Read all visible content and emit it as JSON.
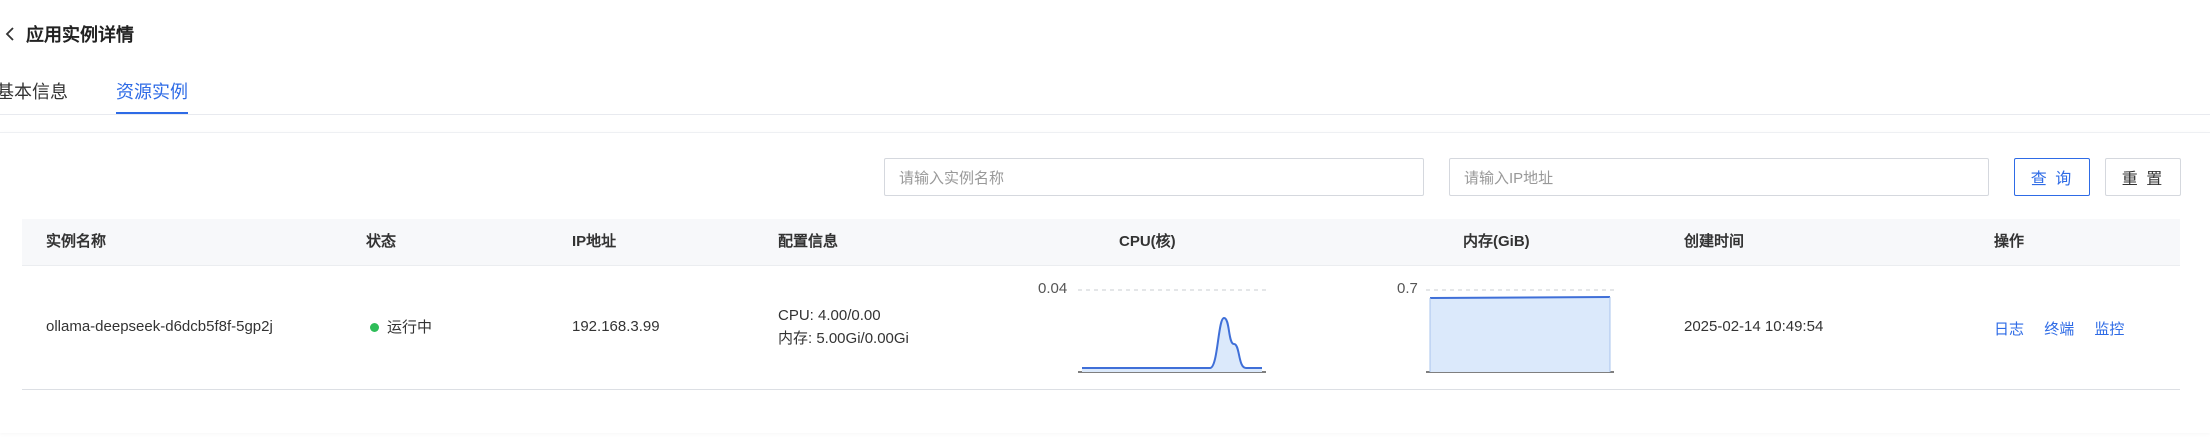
{
  "header": {
    "back_icon": "chevron-left-icon",
    "title": "应用实例详情"
  },
  "tabs": [
    {
      "label": "基本信息",
      "active": false
    },
    {
      "label": "资源实例",
      "active": true
    }
  ],
  "filters": {
    "name_placeholder": "请输入实例名称",
    "ip_placeholder": "请输入IP地址",
    "query_label": "查 询",
    "reset_label": "重 置"
  },
  "table": {
    "columns": [
      "实例名称",
      "状态",
      "IP地址",
      "配置信息",
      "CPU(核)",
      "内存(GiB)",
      "创建时间",
      "操作"
    ],
    "rows": [
      {
        "name": "ollama-deepseek-d6dcb5f8f-5gp2j",
        "status": "运行中",
        "status_color": "#2ebd59",
        "ip": "192.168.3.99",
        "config_cpu": "CPU: 4.00/0.00",
        "config_mem": "内存: 5.00Gi/0.00Gi",
        "cpu_max_label": "0.04",
        "mem_max_label": "0.7",
        "created": "2025-02-14 10:49:54",
        "actions": [
          "日志",
          "终端",
          "监控"
        ]
      }
    ]
  },
  "colors": {
    "accent": "#2e6be6",
    "chart_line": "#3f6fd8",
    "chart_fill": "#dbe9fb",
    "running": "#2ebd59"
  }
}
